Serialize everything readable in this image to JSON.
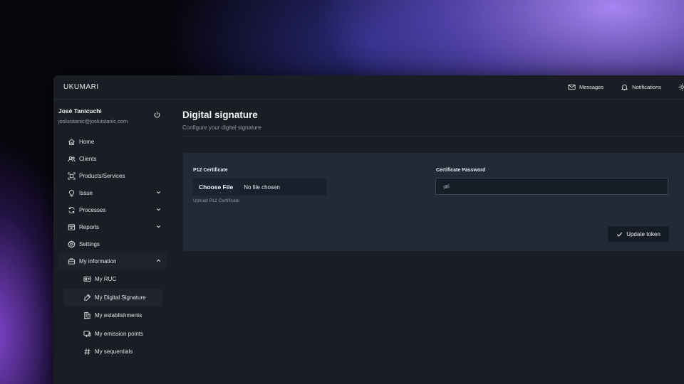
{
  "app": {
    "brand": "UKUMARI"
  },
  "topbar": {
    "messages_label": "Messages",
    "notifications_label": "Notifications"
  },
  "user": {
    "name": "José Tanicuchi",
    "email": "josluistanic@josluistanic.com"
  },
  "sidebar": {
    "items": [
      {
        "label": "Home",
        "icon": "home-icon"
      },
      {
        "label": "Clients",
        "icon": "users-icon"
      },
      {
        "label": "Products/Services",
        "icon": "scan-icon"
      },
      {
        "label": "Issue",
        "icon": "lightbulb-icon",
        "chevron": "down"
      },
      {
        "label": "Processes",
        "icon": "refresh-icon",
        "chevron": "down"
      },
      {
        "label": "Reports",
        "icon": "report-icon",
        "chevron": "down"
      },
      {
        "label": "Settings",
        "icon": "gear-icon"
      },
      {
        "label": "My information",
        "icon": "briefcase-icon",
        "chevron": "up"
      }
    ],
    "sub_items": [
      {
        "label": "My RUC",
        "icon": "id-card-icon"
      },
      {
        "label": "My Digital Signature",
        "icon": "signature-icon",
        "active": true
      },
      {
        "label": "My establishments",
        "icon": "building-icon"
      },
      {
        "label": "My emission points",
        "icon": "monitor-icon"
      },
      {
        "label": "My sequentials",
        "icon": "hash-icon"
      }
    ]
  },
  "page": {
    "title": "Digital signature",
    "subtitle": "Configure your digital signature"
  },
  "form": {
    "certificate_label": "P12 Certificate",
    "choose_file_label": "Choose File",
    "file_status": "No file chosen",
    "certificate_helper": "Upload P12 Certificate",
    "password_label": "Certificate Password",
    "password_value": "",
    "update_button_label": "Update token"
  },
  "colors": {
    "window_bg": "#1a1e24",
    "card_bg": "#212b38",
    "accent_glow": "#9b7cff"
  }
}
